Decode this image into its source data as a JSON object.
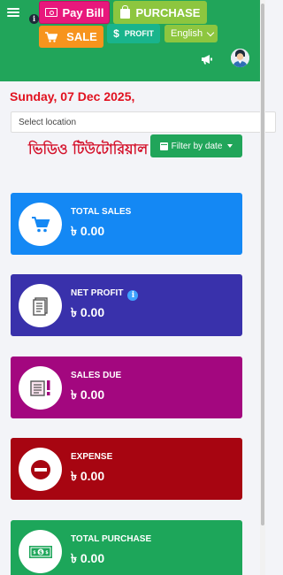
{
  "header": {
    "pay_bill_label": "Pay Bill",
    "purchase_label": "PURCHASE",
    "sale_label": "SALE",
    "profit_label": "PROFIT",
    "language": "English",
    "info_glyph": "i",
    "colors": {
      "header_bg": "#21a55a",
      "pay_bill": "#e8187c",
      "purchase": "#8dc63f",
      "sale": "#f7941d",
      "profit": "#19b48c"
    },
    "icons": [
      "menu-icon",
      "info-icon",
      "bill-icon",
      "bag-icon",
      "cart-icon",
      "dollar-icon",
      "chevron-down-icon",
      "megaphone-icon",
      "avatar"
    ]
  },
  "main": {
    "date": "Sunday, 07 Dec 2025,",
    "location_placeholder": "Select location",
    "video_tutorial": "ভিডিও টিউটোরিয়াল",
    "filter_label": "Filter by date"
  },
  "cards": [
    {
      "label": "TOTAL SALES",
      "amount": "৳ 0.00",
      "color": "#1488f4",
      "icon": "cart-icon"
    },
    {
      "label": "NET PROFIT",
      "amount": "৳ 0.00",
      "color": "#3931ab",
      "icon": "document-icon",
      "info_glyph": "i"
    },
    {
      "label": "SALES DUE",
      "amount": "৳ 0.00",
      "color": "#a3077f",
      "icon": "invoice-alert-icon"
    },
    {
      "label": "EXPENSE",
      "amount": "৳ 0.00",
      "color": "#a70511",
      "icon": "minus-circle-icon"
    },
    {
      "label": "TOTAL PURCHASE",
      "amount": "৳ 0.00",
      "color": "#1da65a",
      "icon": "money-icon"
    }
  ]
}
